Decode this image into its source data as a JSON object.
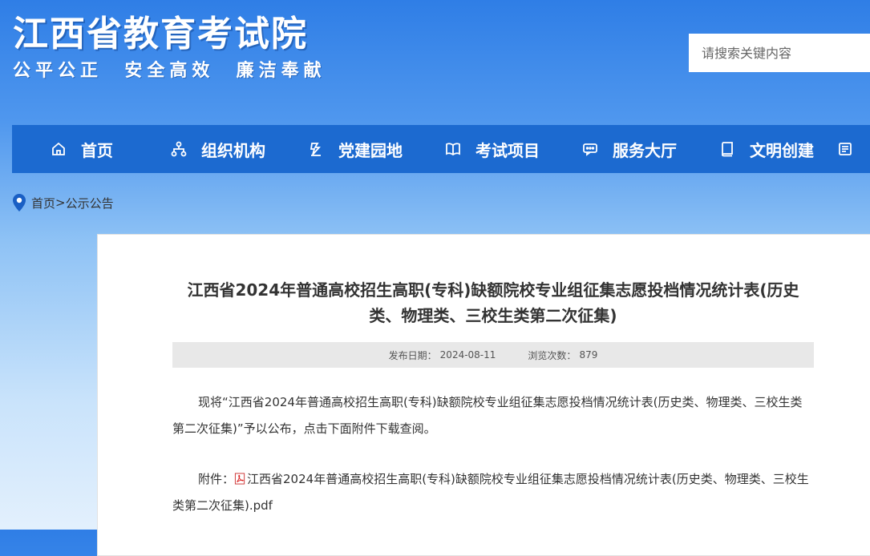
{
  "header": {
    "title": "江西省教育考试院",
    "slogan": "公平公正  安全高效  廉洁奉献"
  },
  "search": {
    "placeholder": "请搜索关键内容"
  },
  "nav": {
    "items": [
      {
        "label": "首页",
        "icon": "home-icon"
      },
      {
        "label": "组织机构",
        "icon": "org-chart-icon"
      },
      {
        "label": "党建园地",
        "icon": "party-building-icon"
      },
      {
        "label": "考试项目",
        "icon": "open-book-icon"
      },
      {
        "label": "服务大厅",
        "icon": "chat-service-icon"
      },
      {
        "label": "文明创建",
        "icon": "book-icon"
      }
    ]
  },
  "breadcrumb": {
    "home": "首页",
    "separator": ">",
    "current": "公示公告"
  },
  "article": {
    "title": "江西省2024年普通高校招生高职(专科)缺额院校专业组征集志愿投档情况统计表(历史类、物理类、三校生类第二次征集)",
    "publish_label": "发布日期：",
    "publish_date": "2024-08-11",
    "views_label": "浏览次数：",
    "views": "879",
    "paragraph1": "现将“江西省2024年普通高校招生高职(专科)缺额院校专业组征集志愿投档情况统计表(历史类、物理类、三校生类第二次征集)”予以公布，点击下面附件下载查阅。",
    "attachment_label": "附件：",
    "attachment_name": "江西省2024年普通高校招生高职(专科)缺额院校专业组征集志愿投档情况统计表(历史类、物理类、三校生类第二次征集).pdf"
  },
  "colors": {
    "nav_bg": "#1c6ad0",
    "header_gradient_top": "#2f7ee6",
    "meta_bg": "#e8e8e8"
  }
}
